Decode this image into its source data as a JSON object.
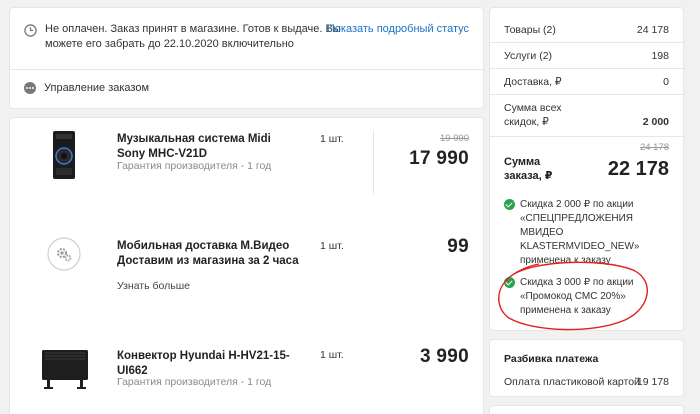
{
  "status": {
    "text": "Не оплачен. Заказ принят в магазине. Готов к выдаче. Вы можете его забрать до 22.10.2020 включительно",
    "link": "Показать подробный статус",
    "manage": "Управление заказом"
  },
  "items": [
    {
      "name": "Музыкальная система Midi Sony MHC-V21D",
      "warranty": "Гарантия производителя - 1 год",
      "qty": "1 шт.",
      "old_price": "19 990",
      "price": "17 990"
    },
    {
      "name": "Мобильная доставка М.Видео Доставим из магазина за 2 часа",
      "qty": "1 шт.",
      "price": "99",
      "more": "Узнать больше"
    },
    {
      "name": "Конвектор Hyundai H-HV21-15-UI662",
      "warranty": "Гарантия производителя - 1 год",
      "qty": "1 шт.",
      "price": "3 990"
    }
  ],
  "summary": {
    "goods_label": "Товары (2)",
    "goods_value": "24 178",
    "services_label": "Услуги (2)",
    "services_value": "198",
    "delivery_label": "Доставка, ₽",
    "delivery_value": "0",
    "discount_label": "Сумма всех скидок, ₽",
    "discount_value": "2 000",
    "total_label": "Сумма заказа, ₽",
    "total_old": "24 178",
    "total_value": "22 178",
    "promo1": "Скидка 2 000 ₽ по акции «СПЕЦПРЕДЛОЖЕНИЯ МВИДЕО KLASTERMVIDEO_NEW» применена к заказу",
    "promo2": "Скидка 3 000 ₽ по акции «Промокод СМС 20%» применена к заказу"
  },
  "payment": {
    "title": "Разбивка платежа",
    "method": "Оплата пластиковой картой",
    "amount": "19 178"
  },
  "colors": {
    "accent_link": "#1a73c9",
    "discount_green": "#2ca24d",
    "annotation_red": "#e02020"
  }
}
